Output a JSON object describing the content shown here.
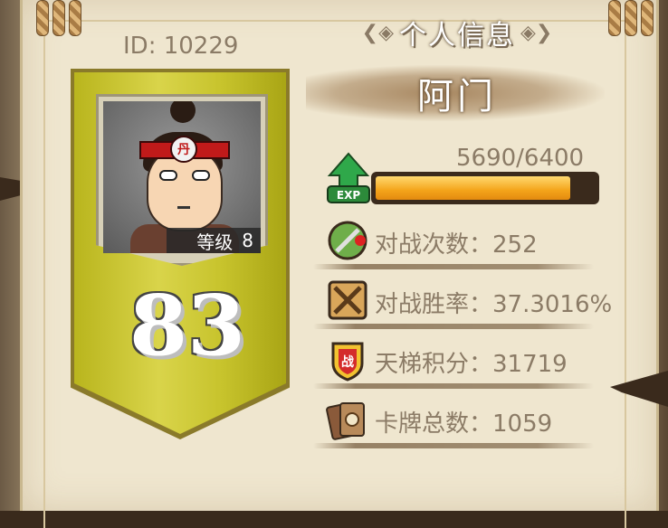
{
  "header": {
    "title": "个人信息",
    "left_ornament": "❮◈",
    "right_ornament": "◈❯"
  },
  "player": {
    "id_label": "ID: 10229",
    "name": "阿门",
    "level_label": "等级",
    "level_value": "8",
    "score_display": "83"
  },
  "exp": {
    "text": "5690/6400",
    "current": 5690,
    "max": 6400,
    "icon_label": "EXP"
  },
  "stats": [
    {
      "label": "对战次数：252",
      "icon": "sword-badge-icon"
    },
    {
      "label": "对战胜率：37.3016%",
      "icon": "crossed-swords-icon"
    },
    {
      "label": "天梯积分：31719",
      "icon": "war-shield-icon"
    },
    {
      "label": "卡牌总数：1059",
      "icon": "card-deck-icon"
    }
  ],
  "badges": {
    "war_char": "战",
    "headband_char": "丹"
  },
  "colors": {
    "paper": "#efe6cf",
    "banner": "#c7c32c",
    "exp_fill": "#f4a41a",
    "text_muted": "#8b7b66"
  }
}
